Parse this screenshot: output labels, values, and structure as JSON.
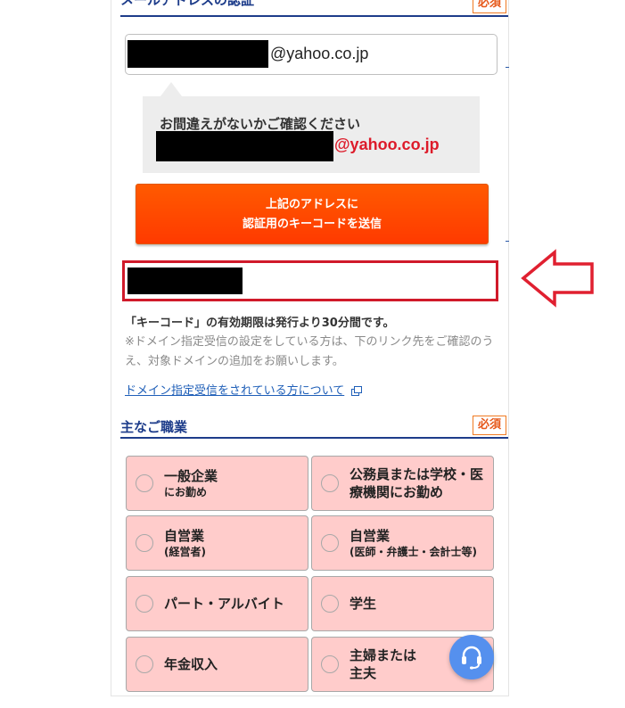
{
  "email_section": {
    "title": "メールアドレスの認証",
    "required": "必須",
    "email_suffix": "@yahoo.co.jp",
    "confirm_message": "お間違えがないかご確認ください",
    "confirm_domain": "@yahoo.co.jp",
    "send_button_line1": "上記のアドレスに",
    "send_button_line2": "認証用のキーコードを送信",
    "keycode_note": "「キーコード」の有効期限は発行より30分間です。",
    "domain_note": "※ドメイン指定受信の設定をしている方は、下のリンク先をご確認のうえ、対象ドメインの追加をお願いします。",
    "domain_link": "ドメイン指定受信をされている方について"
  },
  "job_section": {
    "title": "主なご職業",
    "required": "必須",
    "options": [
      {
        "main": "一般企業",
        "sub": "にお勤め"
      },
      {
        "main": "公務員または学校・医療機関にお勤め"
      },
      {
        "main": "自営業",
        "sub": "(経営者)"
      },
      {
        "main": "自営業",
        "sub": "(医師・弁護士・会計士等)"
      },
      {
        "main": "パート・アルバイト"
      },
      {
        "main": "学生"
      },
      {
        "main": "年金収入"
      },
      {
        "main": "主婦または主夫"
      }
    ]
  },
  "icons": {
    "external_link": "external-link-icon",
    "chat": "headset-icon",
    "pointer": "left-arrow-outline-icon"
  },
  "colors": {
    "heading": "#1d3c8a",
    "required": "#f07a22",
    "send_button": "#ff4e00",
    "highlight_red": "#d01a2a",
    "option_bg": "#ffcccb",
    "link": "#1f5fb8",
    "chat_fab": "#5590ee"
  }
}
